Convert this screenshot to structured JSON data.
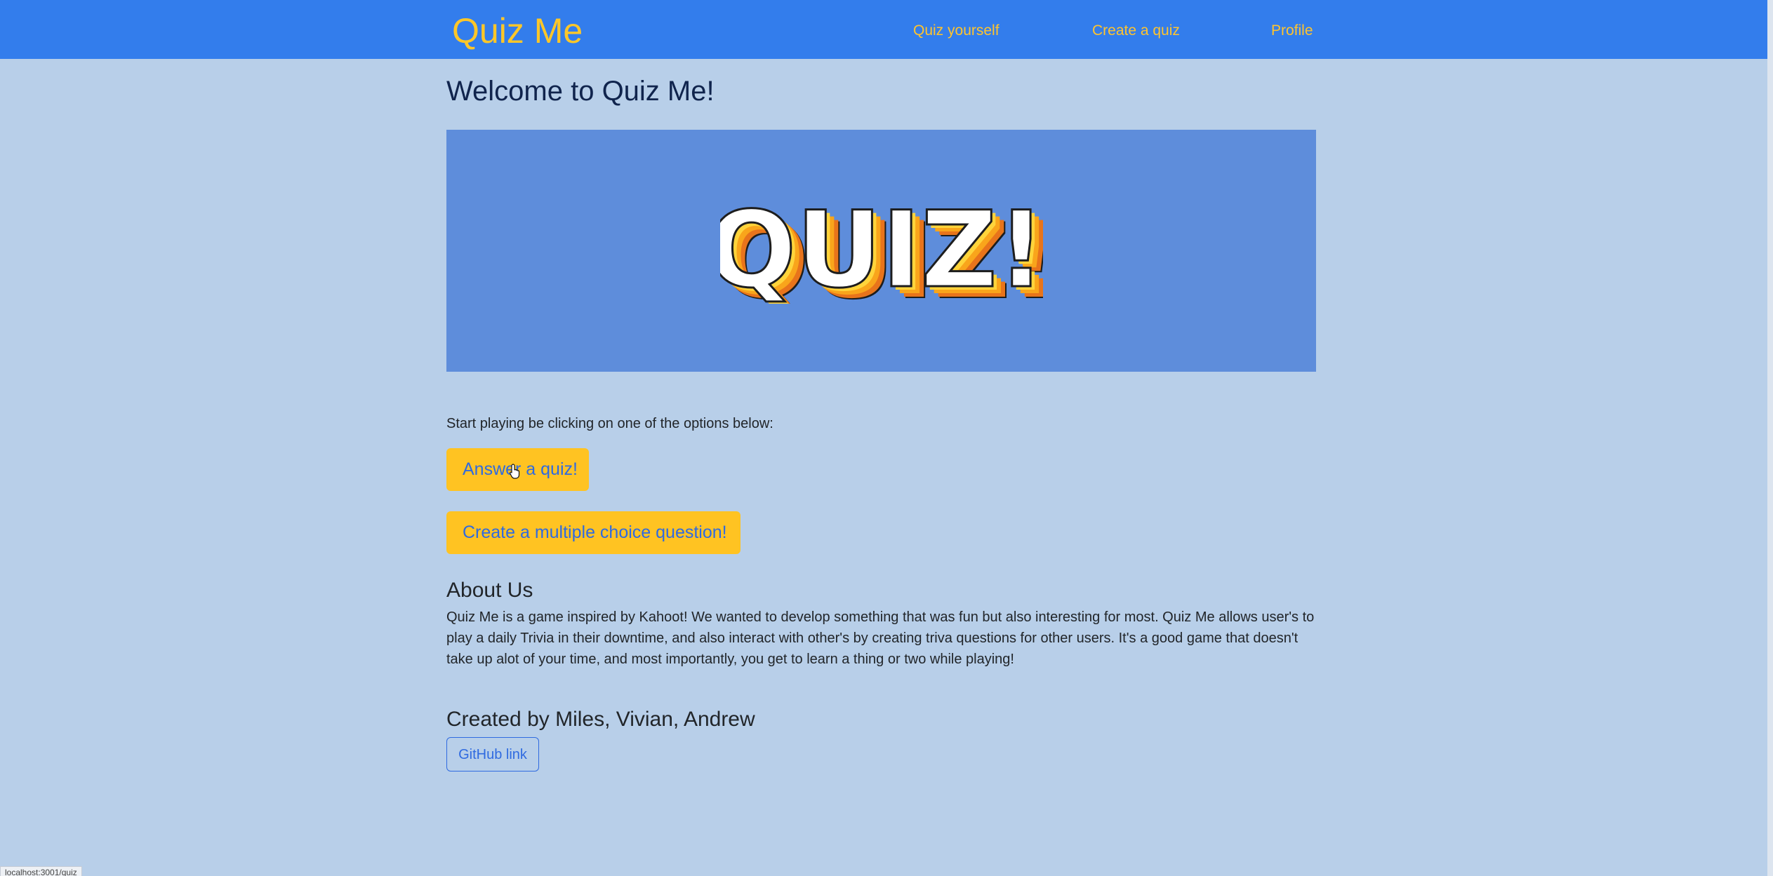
{
  "navbar": {
    "brand": "Quiz Me",
    "links": [
      {
        "label": "Quiz yourself"
      },
      {
        "label": "Create a quiz"
      },
      {
        "label": "Profile"
      }
    ]
  },
  "main": {
    "title": "Welcome to Quiz Me!",
    "hero_text": "QUIZ!",
    "intro": "Start playing be clicking on one of the options below:",
    "answer_button": "Answer a quiz!",
    "create_button": "Create a multiple choice question!"
  },
  "about": {
    "heading": "About Us",
    "text": "Quiz Me is a game inspired by Kahoot! We wanted to develop something that was fun but also interesting for most. Quiz Me allows user's to play a daily Trivia in their downtime, and also interact with other's by creating triva questions for other users. It's a good game that doesn't take up alot of your time, and most importantly, you get to learn a thing or two while playing!"
  },
  "credits": {
    "heading": "Created by Miles, Vivian, Andrew",
    "github_label": "GitHub link"
  },
  "status_bar": {
    "url": "localhost:3001/quiz"
  },
  "colors": {
    "navbar_bg": "#337dec",
    "page_bg": "#b8cfe9",
    "accent_yellow": "#ffc322",
    "link_blue": "#2f6ae0",
    "hero_bg": "#5e8ddb"
  },
  "icons": {
    "cursor": "pointer-hand-icon"
  }
}
